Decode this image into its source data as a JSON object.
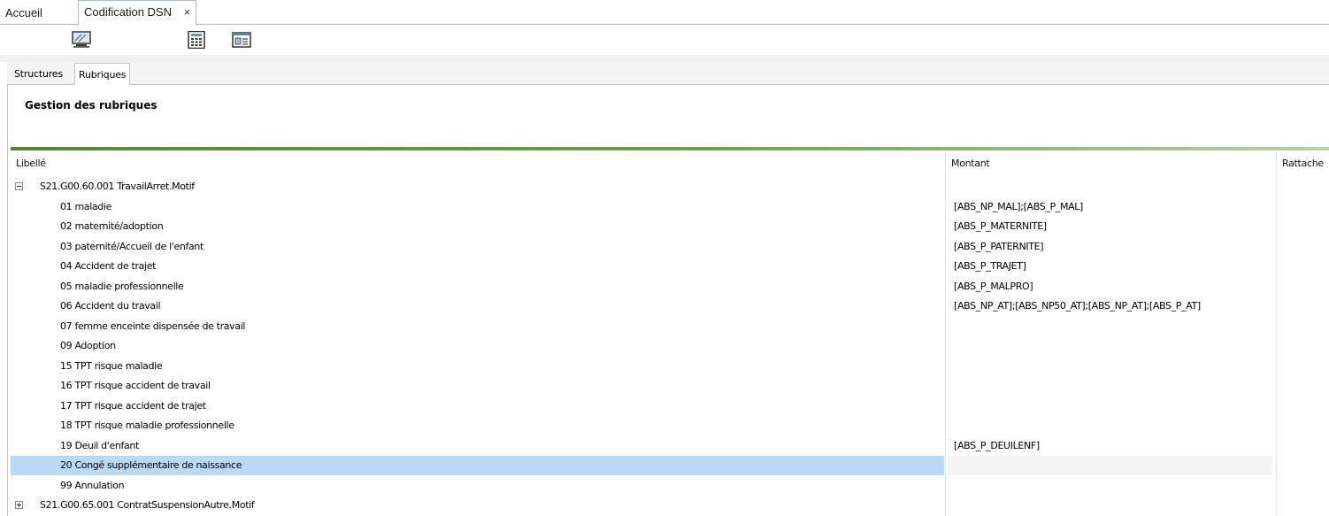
{
  "tabs": {
    "home_label": "Accueil",
    "active_label": "Codification DSN",
    "close_glyph": "×"
  },
  "toolbar": {
    "icons": [
      "monitor-icon",
      "calculator-icon",
      "window-list-icon"
    ]
  },
  "inner_tabs": {
    "structures_label": "Structures",
    "rubriques_label": "Rubriques"
  },
  "panel": {
    "title": "Gestion des rubriques"
  },
  "grid": {
    "columns": {
      "libelle": "Libellé",
      "montant": "Montant",
      "rattache": "Rattache"
    },
    "rows": [
      {
        "level": 0,
        "expander": "minus",
        "label": "S21.G00.60.001 TravailArret.Motif",
        "montant": ""
      },
      {
        "level": 1,
        "label": "01 maladie",
        "montant": "[ABS_NP_MAL];[ABS_P_MAL]"
      },
      {
        "level": 1,
        "label": "02 maternité/adoption",
        "montant": "[ABS_P_MATERNITE]"
      },
      {
        "level": 1,
        "label": "03 paternité/Accueil de l'enfant",
        "montant": "[ABS_P_PATERNITE]"
      },
      {
        "level": 1,
        "label": "04 Accident de trajet",
        "montant": "[ABS_P_TRAJET]"
      },
      {
        "level": 1,
        "label": "05 maladie professionnelle",
        "montant": "[ABS_P_MALPRO]"
      },
      {
        "level": 1,
        "label": "06 Accident du travail",
        "montant": "[ABS_NP_AT];[ABS_NP50_AT];[ABS_NP_AT];[ABS_P_AT]"
      },
      {
        "level": 1,
        "label": "07 femme enceinte dispensée de travail",
        "montant": ""
      },
      {
        "level": 1,
        "label": "09 Adoption",
        "montant": ""
      },
      {
        "level": 1,
        "label": "15 TPT risque maladie",
        "montant": ""
      },
      {
        "level": 1,
        "label": "16 TPT risque accident de travail",
        "montant": ""
      },
      {
        "level": 1,
        "label": "17 TPT risque accident de trajet",
        "montant": ""
      },
      {
        "level": 1,
        "label": "18 TPT risque maladie professionnelle",
        "montant": ""
      },
      {
        "level": 1,
        "label": "19 Deuil d'enfant",
        "montant": "[ABS_P_DEUILENF]"
      },
      {
        "level": 1,
        "label": "20 Congé supplémentaire de naissance",
        "montant": "",
        "selected": true
      },
      {
        "level": 1,
        "label": "99 Annulation",
        "montant": ""
      },
      {
        "level": 0,
        "expander": "plus",
        "label": "S21.G00.65.001 ContratSuspensionAutre.Motif",
        "montant": ""
      }
    ]
  },
  "colors": {
    "selection": "#b9d9f7",
    "accent_rule": "#56843c"
  }
}
